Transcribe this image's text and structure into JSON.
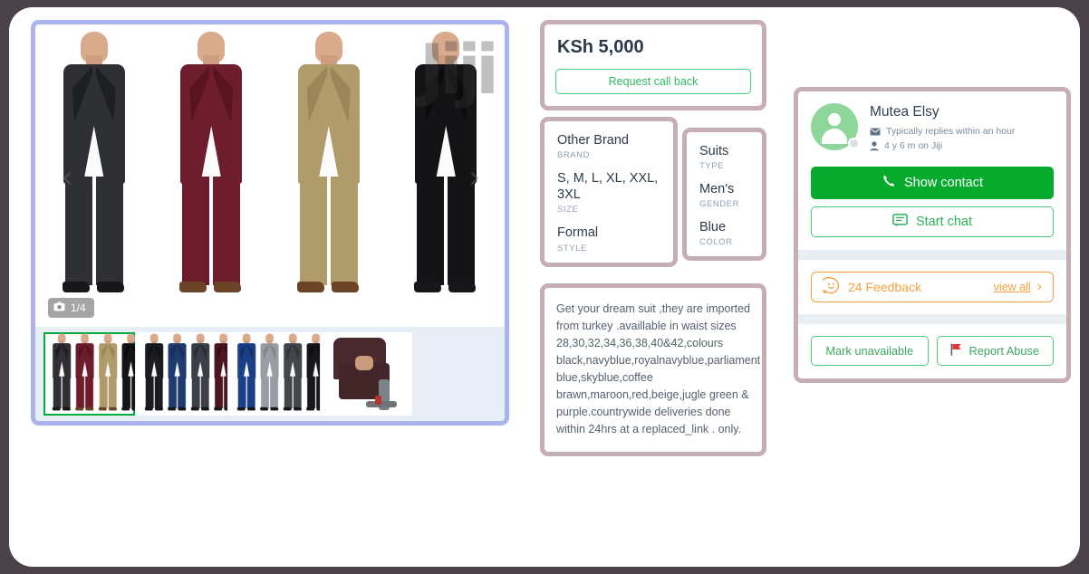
{
  "gallery": {
    "photo_counter": "1/4",
    "camera_icon": "camera-icon",
    "watermark": "Jiji",
    "prev_arrow": "‹",
    "next_arrow": "›",
    "thumbnails": [
      {
        "name": "thumbnail-1",
        "selected": true
      },
      {
        "name": "thumbnail-2",
        "selected": false
      },
      {
        "name": "thumbnail-3",
        "selected": false
      },
      {
        "name": "thumbnail-4",
        "selected": false
      }
    ]
  },
  "price": {
    "amount": "KSh 5,000",
    "request_call_back": "Request call back"
  },
  "attributes_left": [
    {
      "value": "Other Brand",
      "key": "BRAND"
    },
    {
      "value": "S, M, L, XL, XXL, 3XL",
      "key": "SIZE"
    },
    {
      "value": "Formal",
      "key": "STYLE"
    }
  ],
  "attributes_right": [
    {
      "value": "Suits",
      "key": "TYPE"
    },
    {
      "value": "Men's",
      "key": "GENDER"
    },
    {
      "value": "Blue",
      "key": "COLOR"
    }
  ],
  "description": {
    "text": "Get your dream suit ,they are imported from turkey .availlable in waist sizes 28,30,32,34,36,38,40&42,colours black,navyblue,royalnavyblue,parliament blue,skyblue,coffee brawn,maroon,red,beige,jugle green & purple.countrywide deliveries done within 24hrs at a replaced_link . only."
  },
  "seller": {
    "name": "Mutea Elsy",
    "reply_time": "Typically replies within an hour",
    "tenure": "4 y 6 m on Jiji",
    "show_contact": "Show contact",
    "start_chat": "Start chat",
    "feedback_count": "24 Feedback",
    "view_all": "view all",
    "chevron": "›",
    "mark_unavailable": "Mark unavailable",
    "report_abuse": "Report Abuse"
  },
  "colors": {
    "page_bg": "#4a4248",
    "gallery_border": "#aab3ed",
    "card_border": "#c5aeb4",
    "green_primary": "#06ab2e",
    "green_outline": "#4fc97d",
    "orange": "#f2a33f",
    "red_flag": "#e53935",
    "thumb_selected": "#00a83e"
  }
}
